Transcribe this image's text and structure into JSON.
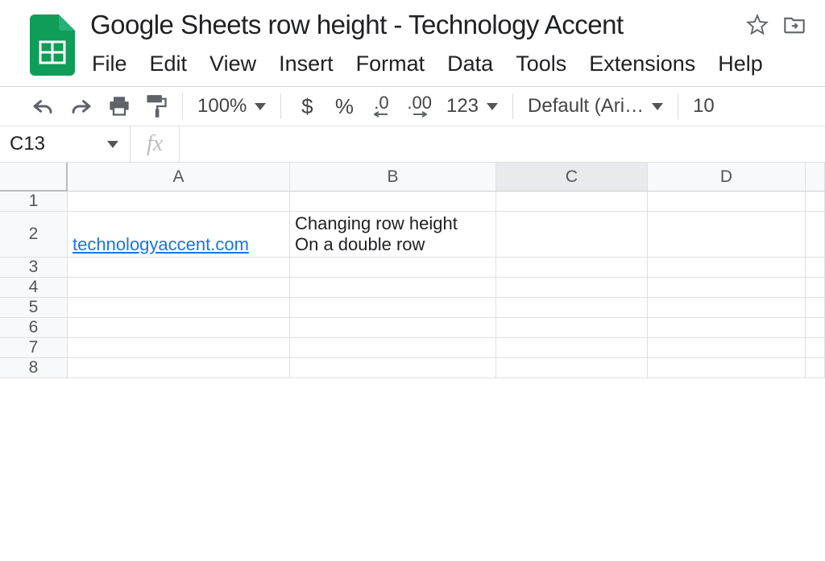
{
  "doc": {
    "title": "Google Sheets row height - Technology Accent"
  },
  "menu": {
    "file": "File",
    "edit": "Edit",
    "view": "View",
    "insert": "Insert",
    "format": "Format",
    "data": "Data",
    "tools": "Tools",
    "extensions": "Extensions",
    "help": "Help"
  },
  "toolbar": {
    "zoom": "100%",
    "currency": "$",
    "percent": "%",
    "dec_dec": ".0",
    "inc_dec": ".00",
    "more_formats": "123",
    "font": "Default (Ari…",
    "font_size": "10"
  },
  "namebox": {
    "value": "C13"
  },
  "fx": {
    "label": "fx",
    "value": ""
  },
  "columns": [
    "A",
    "B",
    "C",
    "D"
  ],
  "rows": [
    "1",
    "2",
    "3",
    "4",
    "5",
    "6",
    "7",
    "8"
  ],
  "cells": {
    "A2": "technologyaccent.com",
    "B2": "Changing row height\nOn a double row"
  }
}
